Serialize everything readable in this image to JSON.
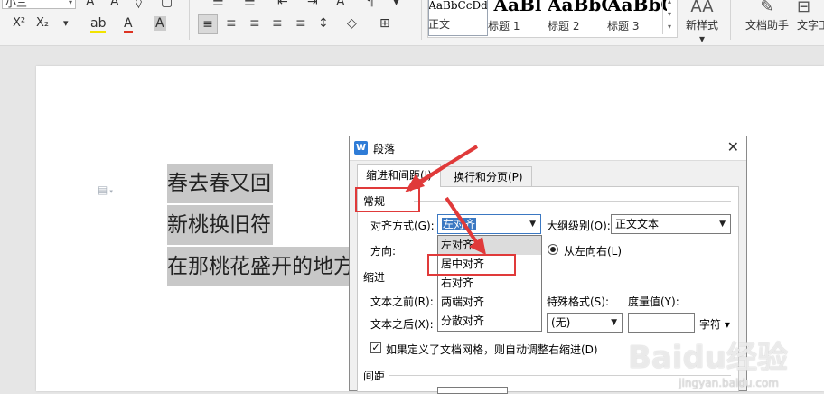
{
  "ribbon": {
    "font_size_value": "小三",
    "style_tiles": [
      {
        "sample": "AaBbCcDd",
        "label": "正文"
      },
      {
        "sample": "AaBl",
        "label": "标题 1"
      },
      {
        "sample": "AaBbC",
        "label": "标题 2"
      },
      {
        "sample": "AaBbC",
        "label": "标题 3"
      }
    ],
    "new_style_label": "新样式",
    "doc_assistant_label": "文档助手",
    "text_tool_label": "文字工"
  },
  "document": {
    "lines": [
      "春去春又回",
      "新桃换旧符",
      "在那桃花盛开的地方"
    ]
  },
  "dialog": {
    "title": "段落",
    "tabs": [
      "缩进和间距(I)",
      "换行和分页(P)"
    ],
    "sections": {
      "general": "常规",
      "indent": "缩进",
      "spacing": "间距"
    },
    "alignment_label": "对齐方式(G):",
    "alignment_value": "左对齐",
    "outline_label": "大纲级别(O):",
    "outline_value": "正文文本",
    "direction_label": "方向:",
    "direction_rtl": "从左向右(L)",
    "text_before_label": "文本之前(R):",
    "text_after_label": "文本之后(X):",
    "special_format_label": "特殊格式(S):",
    "special_format_value": "(无)",
    "measure_label": "度量值(Y):",
    "measure_unit": "字符",
    "grid_checkbox_label": "如果定义了文档网格，则自动调整右缩进(D)",
    "dropdown_options": [
      "左对齐",
      "居中对齐",
      "右对齐",
      "两端对齐",
      "分散对齐"
    ]
  },
  "watermark": {
    "brand": "Baidu经验",
    "site": "jingyan.baidu.com"
  },
  "colors": {
    "annotation_red": "#e03a3a",
    "accent_blue": "#3b78c2"
  }
}
